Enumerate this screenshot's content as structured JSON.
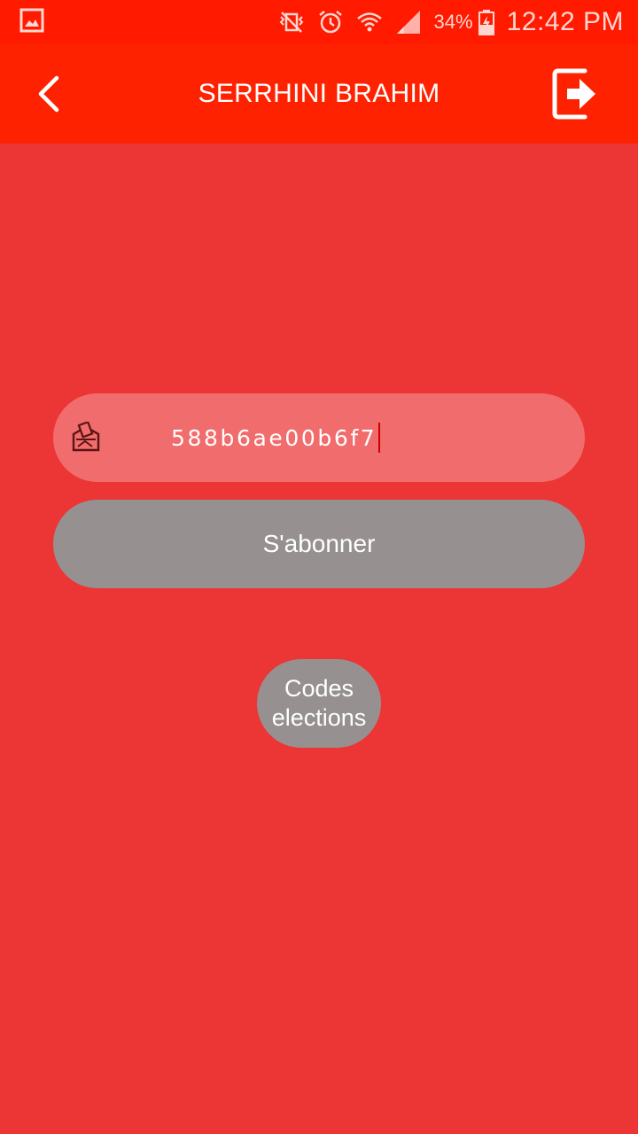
{
  "status_bar": {
    "left_icon": "image-notification-icon",
    "battery_percent": "34%",
    "time": "12:42 PM",
    "icons": [
      "vibrate-mute-icon",
      "alarm-icon",
      "wifi-icon",
      "signal-icon",
      "battery-charging-icon"
    ]
  },
  "app_bar": {
    "title": "SERRHINI BRAHIM",
    "back_icon": "chevron-left-icon",
    "logout_icon": "logout-icon"
  },
  "form": {
    "code_value": "588b6ae00b6f7",
    "code_icon": "ballot-box-icon",
    "subscribe_label": "S'abonner",
    "codes_button_line1": "Codes",
    "codes_button_line2": "elections"
  },
  "colors": {
    "status_bar": "#FF1A00",
    "app_bar": "#FF2200",
    "background": "#EC3535",
    "input_fill": "#F16C6C",
    "button_fill": "#969190"
  }
}
